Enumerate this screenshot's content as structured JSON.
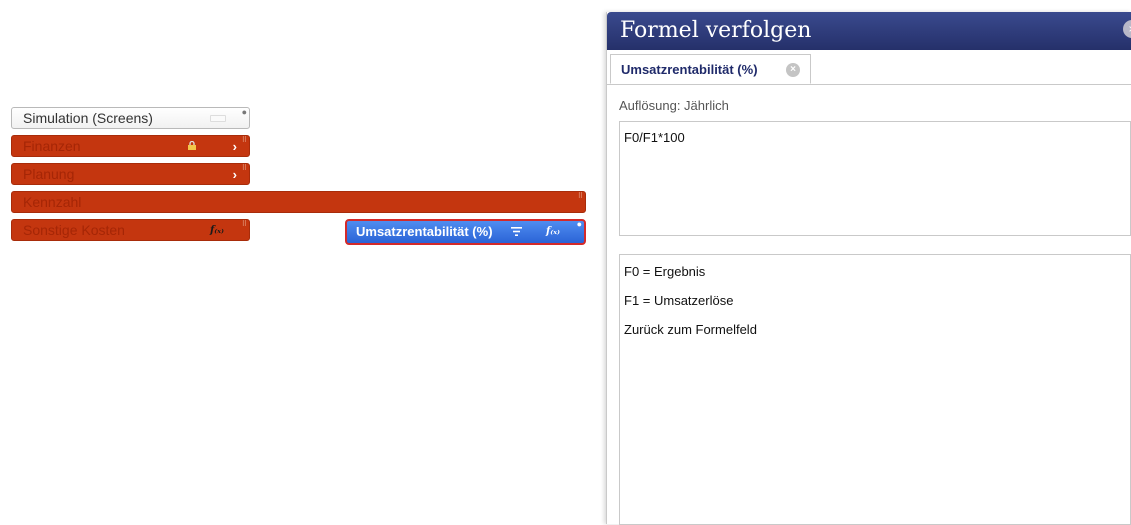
{
  "tree": {
    "simulation": {
      "label": "Simulation (Screens)"
    },
    "finanzen": {
      "label": "Finanzen"
    },
    "planung": {
      "label": "Planung"
    },
    "kennzahl": {
      "label": "Kennzahl"
    },
    "sonstige": {
      "label": "Sonstige Kosten"
    },
    "selected": {
      "label": "Umsatzrentabilität (%)"
    },
    "chevron": "›",
    "fx": "f₍ₓ₎"
  },
  "panel": {
    "title": "Formel verfolgen",
    "close": "×",
    "tab": {
      "label": "Umsatzrentabilität (%)",
      "close": "×"
    },
    "resolution_label": "Auflösung: Jährlich",
    "formula": "F0/F1*100",
    "definitions": [
      "F0 = Ergebnis",
      "F1 = Umsatzerlöse",
      "Zurück zum Formelfeld"
    ]
  },
  "colors": {
    "node_red": "#c4360f",
    "node_blue": "#2b63d6",
    "panel_head": "#25306a"
  }
}
